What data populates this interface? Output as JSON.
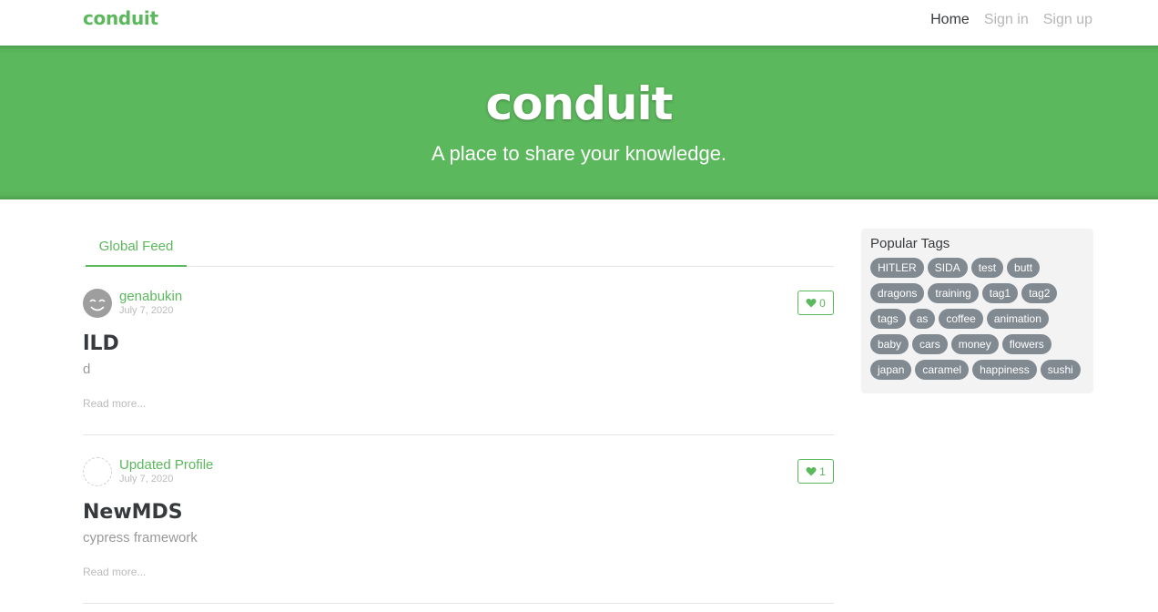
{
  "nav": {
    "brand": "conduit",
    "links": [
      "Home",
      "Sign in",
      "Sign up"
    ]
  },
  "banner": {
    "title": "conduit",
    "subtitle": "A place to share your knowledge."
  },
  "feed": {
    "tab": "Global Feed",
    "articles": [
      {
        "author": "genabukin",
        "date": "July 7, 2020",
        "likes": "0",
        "title": "lLD",
        "description": "d",
        "read_more": "Read more..."
      },
      {
        "author": "Updated Profile",
        "date": "July 7, 2020",
        "likes": "1",
        "title": "NewMDS",
        "description": "cypress framework",
        "read_more": "Read more..."
      }
    ]
  },
  "sidebar": {
    "title": "Popular Tags",
    "tags": [
      "HITLER",
      "SIDA",
      "test",
      "butt",
      "dragons",
      "training",
      "tag1",
      "tag2",
      "tags",
      "as",
      "coffee",
      "animation",
      "baby",
      "cars",
      "money",
      "flowers",
      "japan",
      "caramel",
      "happiness",
      "sushi"
    ]
  },
  "colors": {
    "accent": "#5cb85c",
    "tag_bg": "#818a91",
    "sidebar_bg": "#f3f3f3"
  }
}
